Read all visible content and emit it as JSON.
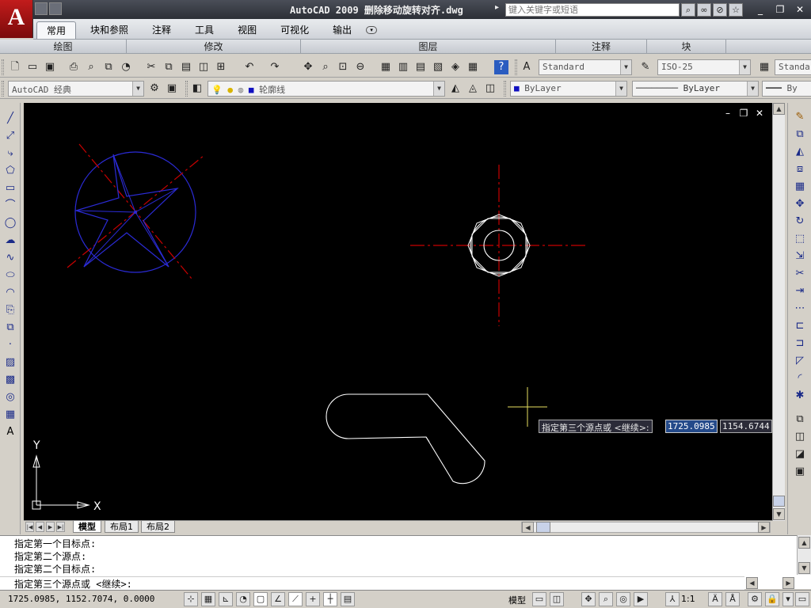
{
  "titlebar": {
    "logo": "A",
    "title": "AutoCAD 2009  删除移动旋转对齐.dwg",
    "arrow": "▸",
    "search_placeholder": "键入关键字或短语",
    "icons": [
      "search-icon",
      "binoculars-icon",
      "star-icon"
    ]
  },
  "window_controls": {
    "minimize": "_",
    "restore": "❐",
    "close": "✕"
  },
  "ribbon": {
    "tabs": [
      "常用",
      "块和参照",
      "注释",
      "工具",
      "视图",
      "可视化",
      "输出"
    ],
    "active_tab": "常用",
    "more": "▾",
    "panels": [
      "绘图",
      "修改",
      "图层",
      "注释",
      "块"
    ]
  },
  "toolbar1": {
    "text_style": "Standard",
    "dim_style": "ISO-25",
    "table_style": "Standar"
  },
  "toolbar2": {
    "workspace": "AutoCAD 经典",
    "layer": "轮廓线",
    "color": "ByLayer",
    "linetype": "ByLayer",
    "lineweight": "By"
  },
  "viewport": {
    "minimize": "–",
    "restore": "❐",
    "close": "✕"
  },
  "dynamic_input": {
    "prompt": "指定第三个源点或 <继续>:",
    "x": "1725.0985",
    "y": "1154.6744"
  },
  "layout_tabs": [
    "模型",
    "布局1",
    "布局2"
  ],
  "ucs": {
    "x": "X",
    "y": "Y"
  },
  "command_history": [
    "指定第一个目标点:",
    "指定第二个源点:",
    "指定第二个目标点:"
  ],
  "command_prompt": "指定第三个源点或 <继续>:",
  "status": {
    "coords": "1725.0985, 1152.7074, 0.0000",
    "model": "模型",
    "scale": "1:1"
  },
  "colors": {
    "canvas": "#000000",
    "star_circle": "#2b2bd6",
    "centerline": "#c80000",
    "part_outline": "#ffffff",
    "crosshair": "#e8e060"
  }
}
